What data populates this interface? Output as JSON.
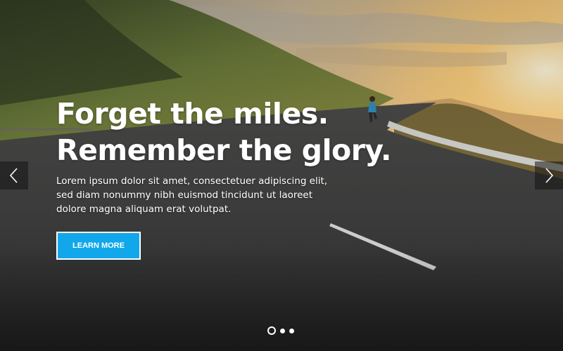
{
  "slide": {
    "headline_line1": "Forget the miles.",
    "headline_line2": "Remember the glory.",
    "body": "Lorem ipsum dolor sit amet, consectetuer adipiscing elit, sed diam nonummy nibh euismod tincidunt ut laoreet dolore magna aliquam erat volutpat.",
    "cta_label": "LEARN MORE"
  },
  "controls": {
    "prev_icon": "chevron-left-icon",
    "next_icon": "chevron-right-icon"
  },
  "pagination": {
    "count": 3,
    "active": 1
  },
  "colors": {
    "accent": "#10a8ea",
    "text": "#ffffff"
  }
}
